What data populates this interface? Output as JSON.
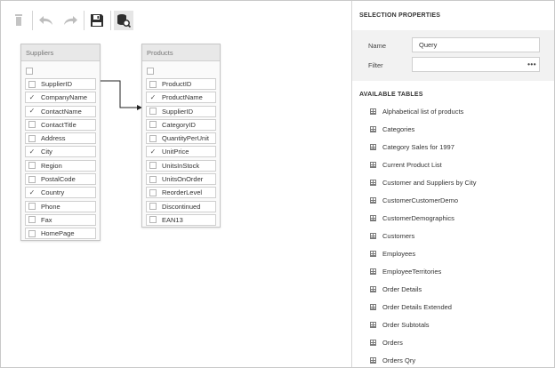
{
  "toolbar": {
    "buttons": [
      {
        "name": "delete",
        "icon": "trash-icon"
      },
      {
        "name": "undo",
        "icon": "undo-icon"
      },
      {
        "name": "redo",
        "icon": "redo-icon"
      },
      {
        "name": "save",
        "icon": "save-icon"
      },
      {
        "name": "data-preview",
        "icon": "database-search-icon"
      }
    ]
  },
  "tables": [
    {
      "name": "Suppliers",
      "fields": [
        {
          "label": "SupplierID",
          "checked": false
        },
        {
          "label": "CompanyName",
          "checked": true
        },
        {
          "label": "ContactName",
          "checked": true
        },
        {
          "label": "ContactTitle",
          "checked": false
        },
        {
          "label": "Address",
          "checked": false
        },
        {
          "label": "City",
          "checked": true
        },
        {
          "label": "Region",
          "checked": false
        },
        {
          "label": "PostalCode",
          "checked": false
        },
        {
          "label": "Country",
          "checked": true
        },
        {
          "label": "Phone",
          "checked": false
        },
        {
          "label": "Fax",
          "checked": false
        },
        {
          "label": "HomePage",
          "checked": false
        }
      ]
    },
    {
      "name": "Products",
      "fields": [
        {
          "label": "ProductID",
          "checked": false
        },
        {
          "label": "ProductName",
          "checked": true
        },
        {
          "label": "SupplierID",
          "checked": false
        },
        {
          "label": "CategoryID",
          "checked": false
        },
        {
          "label": "QuantityPerUnit",
          "checked": false
        },
        {
          "label": "UnitPrice",
          "checked": true
        },
        {
          "label": "UnitsInStock",
          "checked": false
        },
        {
          "label": "UnitsOnOrder",
          "checked": false
        },
        {
          "label": "ReorderLevel",
          "checked": false
        },
        {
          "label": "Discontinued",
          "checked": false
        },
        {
          "label": "EAN13",
          "checked": false
        }
      ]
    }
  ],
  "panel": {
    "selection_title": "SELECTION PROPERTIES",
    "name_label": "Name",
    "name_value": "Query",
    "filter_label": "Filter",
    "filter_value": "",
    "filter_button": "•••",
    "available_title": "AVAILABLE TABLES",
    "available_tables": [
      "Alphabetical list of products",
      "Categories",
      "Category Sales for 1997",
      "Current Product List",
      "Customer and Suppliers by City",
      "CustomerCustomerDemo",
      "CustomerDemographics",
      "Customers",
      "Employees",
      "EmployeeTerritories",
      "Order Details",
      "Order Details Extended",
      "Order Subtotals",
      "Orders",
      "Orders Qry"
    ]
  }
}
